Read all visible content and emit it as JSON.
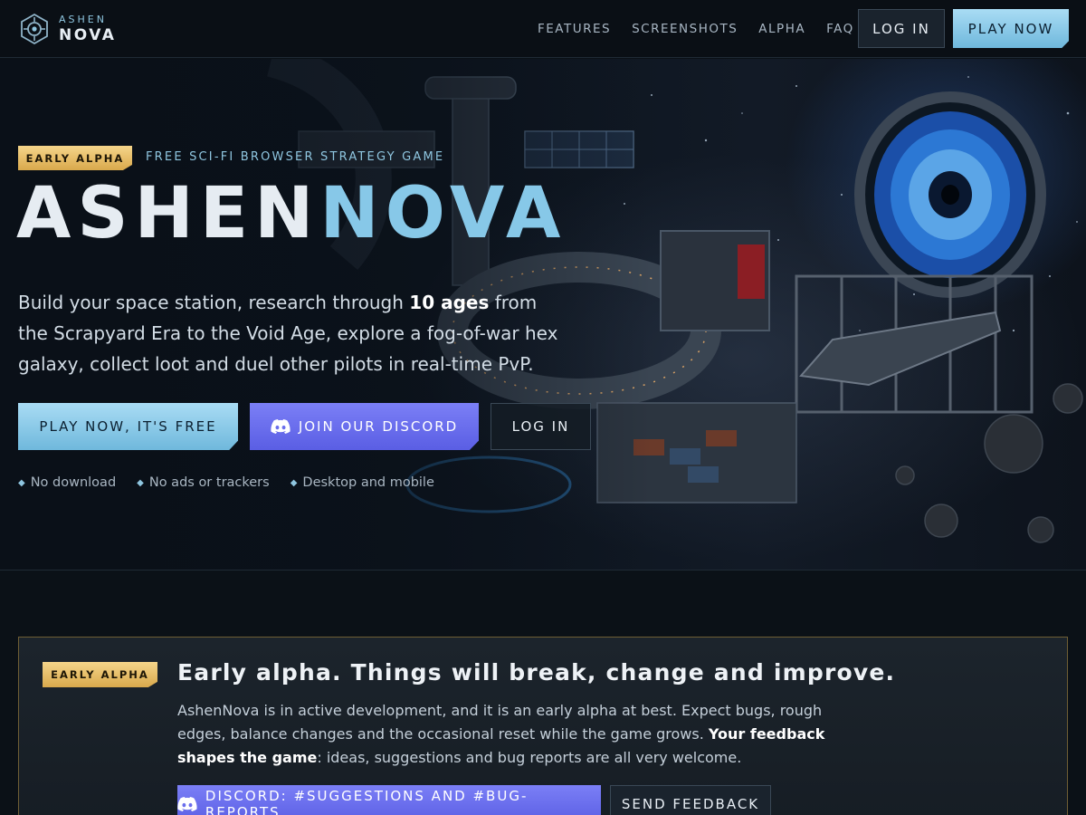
{
  "brand": {
    "small": "ASHEN",
    "big": "NOVA",
    "logo_icon": "hex-reticle-icon"
  },
  "nav": {
    "links": [
      "FEATURES",
      "SCREENSHOTS",
      "ALPHA",
      "FAQ"
    ],
    "login_label": "LOG IN",
    "play_label": "PLAY NOW"
  },
  "hero": {
    "badge": "EARLY ALPHA",
    "tagline": "FREE SCI-FI BROWSER STRATEGY GAME",
    "title_part1": "ASHEN",
    "title_part2": "NOVA",
    "desc_before": "Build your space station, research through ",
    "desc_bold": "10 ages",
    "desc_after": " from the Scrapyard Era to the Void Age, explore a fog-of-war hex galaxy, collect loot and duel other pilots in real-time PvP.",
    "play_label": "PLAY NOW, IT'S FREE",
    "discord_label": "JOIN OUR DISCORD",
    "login_label": "LOG IN",
    "perks": [
      "No download",
      "No ads or trackers",
      "Desktop and mobile"
    ],
    "perk_icon": "diamond-bullet-icon"
  },
  "alpha_card": {
    "badge": "EARLY ALPHA",
    "title": "Early alpha. Things will break, change and improve.",
    "body_before": "AshenNova is in active development, and it is an early alpha at best. Expect bugs, rough edges, balance changes and the occasional reset while the game grows. ",
    "body_bold": "Your feedback shapes the game",
    "body_after": ": ideas, suggestions and bug reports are all very welcome.",
    "discord_label": "DISCORD: #SUGGESTIONS AND #BUG-REPORTS",
    "feedback_label": "SEND FEEDBACK"
  },
  "colors": {
    "accent_blue": "#87c8e8",
    "discord_purple": "#5a5ee4",
    "alpha_gold": "#e8bd62",
    "background": "#0b1117"
  }
}
